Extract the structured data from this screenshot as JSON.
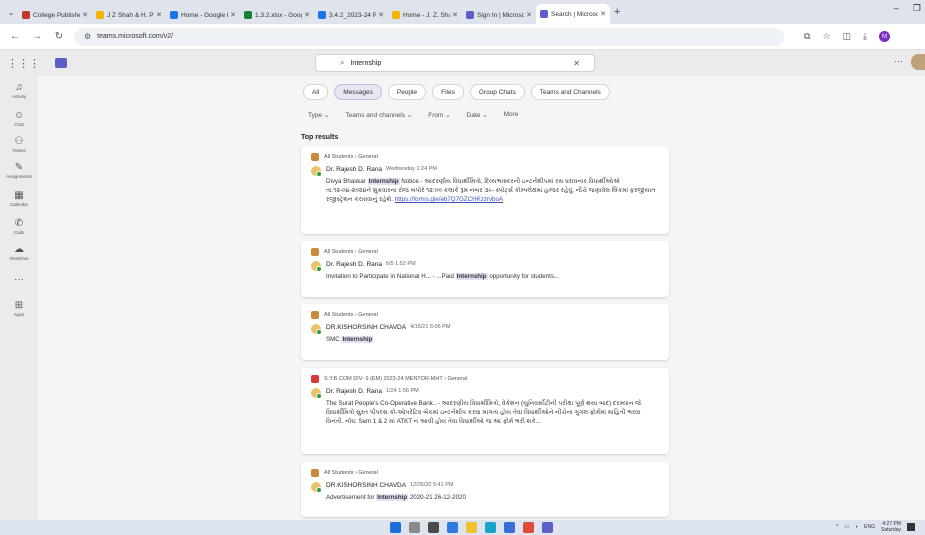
{
  "browser": {
    "tabs": [
      {
        "title": "College Published Book (",
        "color": "#c0392b"
      },
      {
        "title": "J Z Shah & H. P Desai Co",
        "color": "#f5b400"
      },
      {
        "title": "Home - Google Drive",
        "color": "#1a73e8"
      },
      {
        "title": "1.3.2.xlsx - Google Sheets",
        "color": "#188038"
      },
      {
        "title": "3.4.2_2023-24 Recognitio",
        "color": "#1a73e8"
      },
      {
        "title": "Home - J. Z. Shah Arts &",
        "color": "#f5b400"
      },
      {
        "title": "Sign In | Microsoft Teams",
        "color": "#5b5fc7"
      },
      {
        "title": "Search | Microsoft Teams",
        "color": "#5b5fc7",
        "active": true
      }
    ],
    "url": "teams.microsoft.com/v2/",
    "profile_initial": "M"
  },
  "search": {
    "query": "Internship"
  },
  "rail": [
    {
      "icon": "activity-icon",
      "glyph": "♫",
      "label": "Activity"
    },
    {
      "icon": "chat-icon",
      "glyph": "☺",
      "label": "Chat"
    },
    {
      "icon": "teams-icon",
      "glyph": "⚇",
      "label": "Teams"
    },
    {
      "icon": "assignments-icon",
      "glyph": "✎",
      "label": "Assignments"
    },
    {
      "icon": "calendar-icon",
      "glyph": "▦",
      "label": "Calendar"
    },
    {
      "icon": "calls-icon",
      "glyph": "✆",
      "label": "Calls"
    },
    {
      "icon": "onedrive-icon",
      "glyph": "☁",
      "label": "OneDrive"
    },
    {
      "icon": "more-icon",
      "glyph": "···",
      "label": ""
    },
    {
      "icon": "apps-icon",
      "glyph": "⊞",
      "label": "Apps"
    }
  ],
  "filters": [
    "All",
    "Messages",
    "People",
    "Files",
    "Group Chats",
    "Teams and Channels"
  ],
  "selected_filter": "Messages",
  "dropdowns": [
    "Type ⌄",
    "Teams and channels ⌄",
    "From ⌄",
    "Date ⌄",
    "More"
  ],
  "section_title": "Top results",
  "results": [
    {
      "channel": "All Students  ›  General",
      "channel_color": "#c98b3a",
      "author": "Dr. Rajesh D. Rana",
      "time": "Wednesday 1:24 PM",
      "pre": "Divya Bhaskar ",
      "keyword": "Internship",
      "post": " Notice - આદરણીય વિધાર્થીમિત્રો, દિવ્યભાસ્કરની ઇન્ટર્નશીપમાં રસ ધરાવનાર વિધાર્થીઓએ તા.૧૨-૦૪-૨૦૨૪ને શુક્રવારના રોજ બપોરે ૧૨:૦૦ કલાકે રૂમ નંબર ૩૯- સ્પોર્ટ્સ કોમ્પલેક્ષમાં હાજર રહેવું. નીચે જણાવેલ લિંકમાં ફરજીયાત રજીસ્ટ્રેશન કરાવવાનું રહેશે. ",
      "link": "https://forms.gle/eb7Q7GZCHKzzrvboA"
    },
    {
      "channel": "All Students  ›  General",
      "channel_color": "#c98b3a",
      "author": "Dr. Rajesh D. Rana",
      "time": "6/5 1:52 PM",
      "pre": "Invitation to Participate in National H...  - ...Paid ",
      "keyword": "Internship",
      "post": " opportunity for students...",
      "link": ""
    },
    {
      "channel": "All Students  ›  General",
      "channel_color": "#c98b3a",
      "author": "DR.KISHORSINH CHAVDA",
      "time": "4/15/21 5:06 PM",
      "pre": "SMC ",
      "keyword": "Internship",
      "post": "",
      "link": ""
    },
    {
      "channel": "S.Y.B.COM DIV- 9 (EM) 2023-24 MENTOR-MHT  ›  General",
      "channel_color": "#d93a3a",
      "author": "Dr. Rajesh D. Rana",
      "time": "1/24 1:56 PM",
      "pre": "The Surat People's Co-Operative Bank..  - આદરણીય વિધાર્થીમિત્રો, વેકેશન (યુનિવર્સીટીની પરીક્ષા પૂર્ણ થયા બાદ) દરમ્યાન જે વિધાર્થીમિત્રો સુરત પીપલ્સ કો-ઓપરેટિવ બેંકમાં ઇન્ટર્નશીપ કરવા માંગતા હોય તેવા વિધાર્થીઓને નીચેના ગુગલ ફોર્મમાં માહિતી ભરવા વિનંતી. નોંધ: Sem 1 & 2 માં ATKT ન આવી હોય તેવા વિધાર્થીઓ જ આ ફોર્મ ભરી શકે...",
      "keyword": "",
      "post": "",
      "link": ""
    },
    {
      "channel": "All Students  ›  General",
      "channel_color": "#c98b3a",
      "author": "DR.KISHORSINH CHAVDA",
      "time": "12/26/20 5:41 PM",
      "pre": "Advertisement for ",
      "keyword": "Internship",
      "post": " 2020-21 26-12-2020",
      "link": ""
    }
  ],
  "taskbar": {
    "icons": [
      {
        "name": "windows-start-icon",
        "color": "#1e6fd9"
      },
      {
        "name": "search-taskbar-icon",
        "color": "#8a8a8a"
      },
      {
        "name": "task-view-icon",
        "color": "#4a4a4a"
      },
      {
        "name": "widgets-icon",
        "color": "#2d7be0"
      },
      {
        "name": "file-explorer-icon",
        "color": "#f2c12e"
      },
      {
        "name": "edge-icon",
        "color": "#1aa3c9"
      },
      {
        "name": "store-icon",
        "color": "#3a6fd8"
      },
      {
        "name": "chrome-icon",
        "color": "#e04a3a"
      },
      {
        "name": "teams-taskbar-icon",
        "color": "#5b5fc7"
      }
    ],
    "lang": "ENG",
    "time": "4:27 PM",
    "day": "Saturday"
  }
}
